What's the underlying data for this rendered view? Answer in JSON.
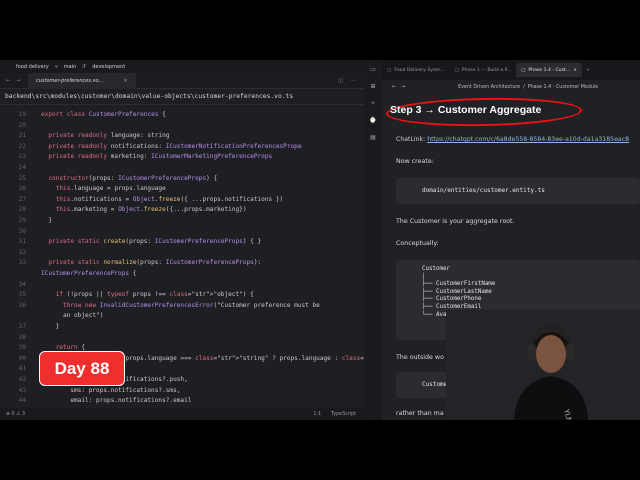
{
  "editor": {
    "project": "food delivery",
    "branch": "main",
    "env": "development",
    "tab": "customer-preferences.vo...",
    "path": "backend\\src\\modules\\customer\\domain\\value-objects\\customer-preferences.vo.ts",
    "status_left": "⊗ 0  ⚠ 3",
    "status_pos": "1:1",
    "status_lang": "TypeScript"
  },
  "code": {
    "lines": [
      {
        "n": "19",
        "t": "export class CustomerPreferences {"
      },
      {
        "n": "20",
        "t": ""
      },
      {
        "n": "21",
        "t": "  private readonly language: string"
      },
      {
        "n": "22",
        "t": "  private readonly notifications: ICustomerNotificationPreferencesPrope"
      },
      {
        "n": "23",
        "t": "  private readonly marketing: ICustomerMarketingPreferenceProps"
      },
      {
        "n": "24",
        "t": ""
      },
      {
        "n": "25",
        "t": "  constructor(props: ICustomerPreferenceProps) {"
      },
      {
        "n": "26",
        "t": "    this.language = props.language"
      },
      {
        "n": "27",
        "t": "    this.notifications = Object.freeze({ ...props.notifications })"
      },
      {
        "n": "28",
        "t": "    this.marketing = Object.freeze({...props.marketing})"
      },
      {
        "n": "29",
        "t": "  }"
      },
      {
        "n": "30",
        "t": ""
      },
      {
        "n": "31",
        "t": "  private static create(props: ICustomerPreferenceProps) { }"
      },
      {
        "n": "32",
        "t": ""
      },
      {
        "n": "33",
        "t": "  private static normalize(props: ICustomerPreferenceProps):"
      },
      {
        "n": "",
        "t": "ICustomerPreferenceProps {"
      },
      {
        "n": "34",
        "t": ""
      },
      {
        "n": "35",
        "t": "    if (!props || typeof props !== \"object\") {"
      },
      {
        "n": "36",
        "t": "      throw new InvalidCustomerPreferencesError(\"Customer preference must be"
      },
      {
        "n": "",
        "t": "      an object\")"
      },
      {
        "n": "37",
        "t": "    }"
      },
      {
        "n": "38",
        "t": ""
      },
      {
        "n": "39",
        "t": "    return {"
      },
      {
        "n": "40",
        "t": "      language: typeof props.language === \"string\" ? props.language : \"\","
      },
      {
        "n": "41",
        "t": "      notifications: {"
      },
      {
        "n": "42",
        "t": "        push: props.notifications?.push,"
      },
      {
        "n": "43",
        "t": "        sms: props.notifications?.sms,"
      },
      {
        "n": "44",
        "t": "        email: props.notifications?.email"
      }
    ]
  },
  "badge": "Day 88",
  "browser": {
    "tabs": [
      "Food Delivery Syste...",
      "Phase 1 — Build a P...",
      "Phase 1.4 - Cust..."
    ],
    "breadcrumb_1": "Event Driven Architecture",
    "breadcrumb_sep": "/",
    "breadcrumb_2": "Phase 1.4 - Customer Module",
    "heading": "Step 3 → Customer Aggregate",
    "chatlink_label": "ChatLink: ",
    "chatlink_url": "https://chatgpt.com/c/6a8de558-8584-83ee-a10d-da1a3185eac8",
    "now_create": "Now create:",
    "file_path": "domain/entities/customer.entity.ts",
    "aggregate_root": "The Customer is your aggregate root.",
    "conceptually": "Conceptually:",
    "tree": "Customer\n│\n├── CustomerFirstName\n├── CustomerLastName\n├── CustomerPhone\n├── CustomerEmail\n└── Avatar",
    "outside": "The outside wo",
    "customer_code": "Customer",
    "rather": "rather than ma"
  },
  "colors": {
    "badge": "#f12e2e",
    "keyword": "#e06c8a",
    "type": "#b48ee8",
    "link": "#8ab4f8",
    "circle": "#ee1111"
  }
}
